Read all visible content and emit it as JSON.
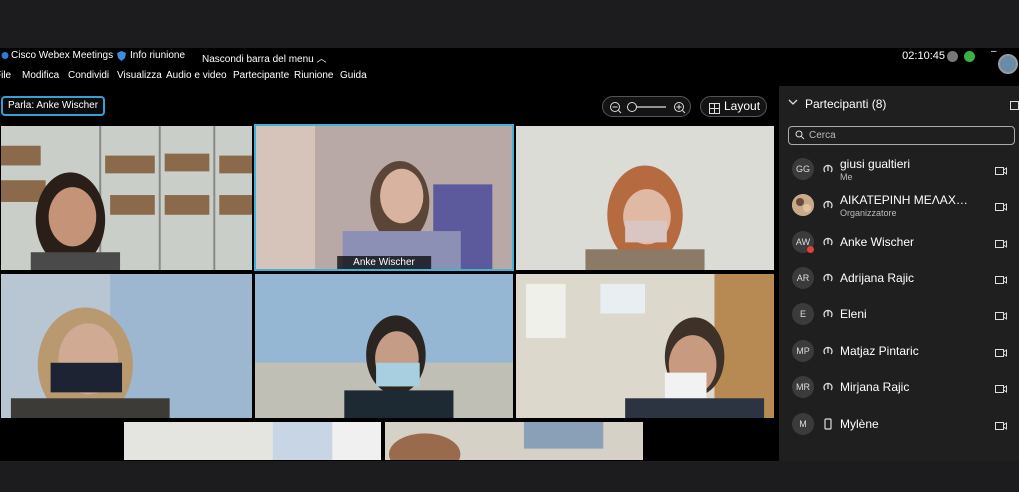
{
  "titlebar": {
    "app_name": "Cisco Webex Meetings",
    "meeting_info": "Info riunione",
    "hide_menu": "Nascondi barra del menu",
    "clock": "02:10:45"
  },
  "menubar": {
    "items": [
      "File",
      "Modifica",
      "Condividi",
      "Visualizza",
      "Audio e video",
      "Partecipante",
      "Riunione",
      "Guida"
    ]
  },
  "toolbar": {
    "speaking_prefix": "Parla:",
    "speaking_name": "Anke Wischer",
    "layout_label": "Layout"
  },
  "video_grid": {
    "active_label": "Anke Wischer"
  },
  "participants": {
    "title": "Partecipanti (8)",
    "search_placeholder": "Cerca",
    "list": [
      {
        "initials": "GG",
        "name": "giusi gualtieri",
        "role": "Me"
      },
      {
        "initials": "",
        "name": "ΑΙΚΑΤΕΡΙΝΗ ΜΕΛΑΧΡΟΙ...",
        "role": "Organizzatore"
      },
      {
        "initials": "AW",
        "name": "Anke Wischer",
        "role": ""
      },
      {
        "initials": "AR",
        "name": "Adrijana Rajic",
        "role": ""
      },
      {
        "initials": "E",
        "name": "Eleni",
        "role": ""
      },
      {
        "initials": "MP",
        "name": "Matjaz Pintaric",
        "role": ""
      },
      {
        "initials": "MR",
        "name": "Mirjana Rajic",
        "role": ""
      },
      {
        "initials": "M",
        "name": "Mylène",
        "role": ""
      }
    ]
  },
  "colors": {
    "accent": "#3fb4d8",
    "panel_bg": "#1f1f1f",
    "status_green": "#3cb043"
  }
}
